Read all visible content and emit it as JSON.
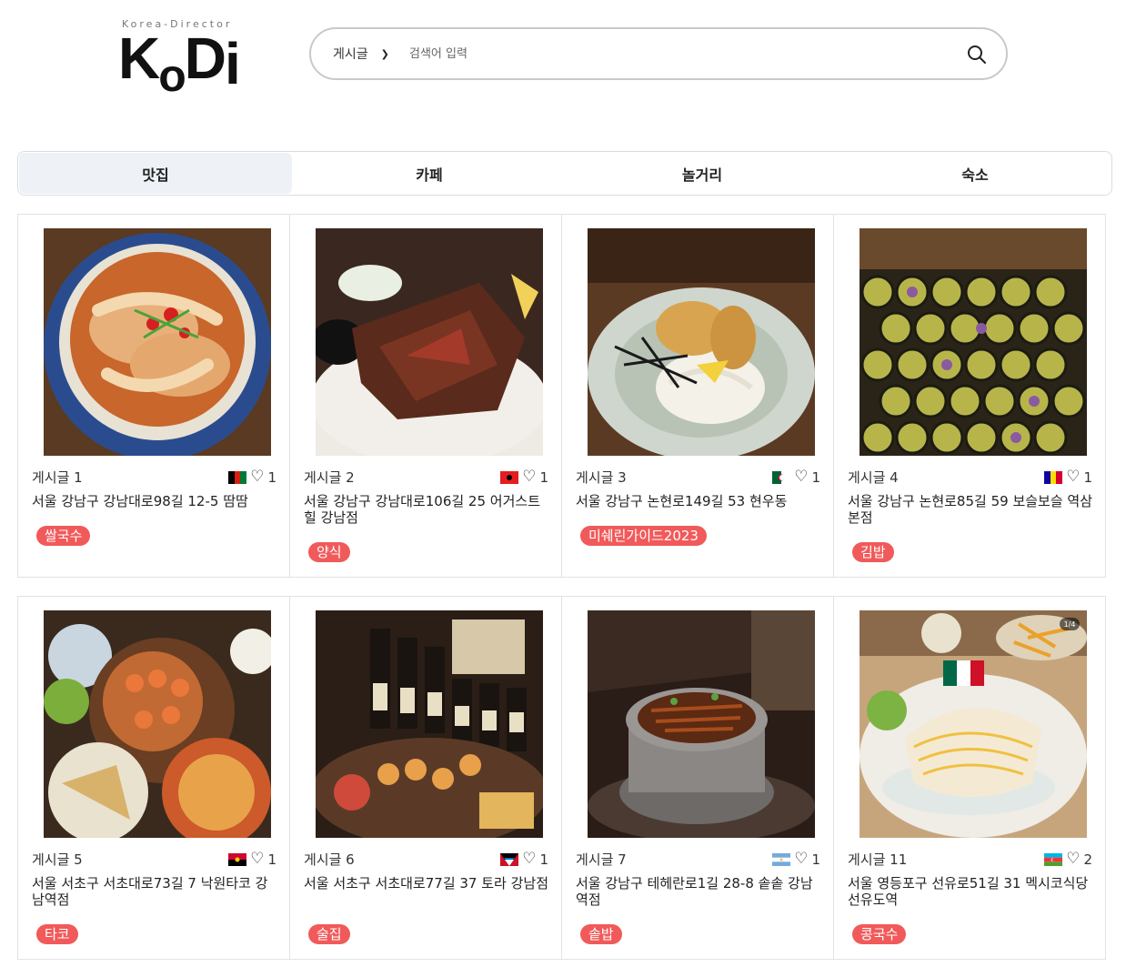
{
  "logo": {
    "subtitle": "Korea-Director",
    "text_k": "K",
    "text_o": "o",
    "text_d": "D",
    "text_i": "i"
  },
  "search": {
    "select_value": "게시글",
    "placeholder": "검색어 입력"
  },
  "tabs": [
    {
      "label": "맛집",
      "active": true
    },
    {
      "label": "카페",
      "active": false
    },
    {
      "label": "놀거리",
      "active": false
    },
    {
      "label": "숙소",
      "active": false
    }
  ],
  "posts": [
    {
      "title": "게시글 1",
      "likes": "1",
      "flag": "afghanistan",
      "address": "서울 강남구 강남대로98길 12-5 땀땀",
      "tag": "쌀국수"
    },
    {
      "title": "게시글 2",
      "likes": "1",
      "flag": "albania",
      "address": "서울 강남구 강남대로106길 25 어거스트힐 강남점",
      "tag": "양식"
    },
    {
      "title": "게시글 3",
      "likes": "1",
      "flag": "algeria",
      "address": "서울 강남구 논현로149길 53 현우동",
      "tag": "미쉐린가이드2023"
    },
    {
      "title": "게시글 4",
      "likes": "1",
      "flag": "andorra",
      "address": "서울 강남구 논현로85길 59 보슬보슬 역삼본점",
      "tag": "김밥"
    },
    {
      "title": "게시글 5",
      "likes": "1",
      "flag": "angola",
      "address": "서울 서초구 서초대로73길 7 낙원타코 강남역점",
      "tag": "타코"
    },
    {
      "title": "게시글 6",
      "likes": "1",
      "flag": "antigua",
      "address": "서울 서초구 서초대로77길 37 토라 강남점",
      "tag": "술집"
    },
    {
      "title": "게시글 7",
      "likes": "1",
      "flag": "argentina",
      "address": "서울 강남구 테헤란로1길 28-8 솥솥 강남역점",
      "tag": "솥밥"
    },
    {
      "title": "게시글 11",
      "likes": "2",
      "flag": "azerbaijan",
      "address": "서울 영등포구 선유로51길 31 멕시코식당 선유도역",
      "tag": "콩국수",
      "image_badge": "1/4"
    }
  ],
  "colors": {
    "tag_bg": "#f15a5a",
    "tab_active_bg": "#eef2f6"
  }
}
